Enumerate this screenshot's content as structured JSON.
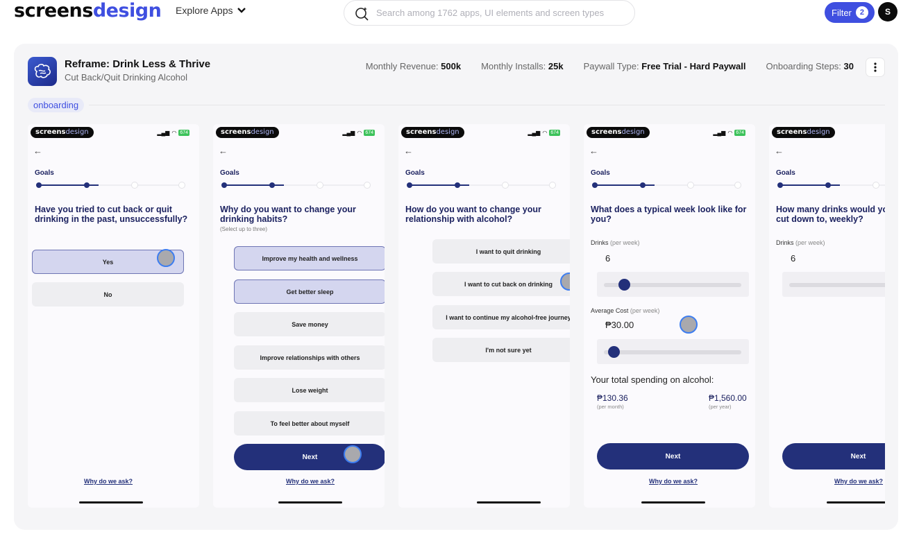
{
  "topbar": {
    "logo_a": "screens",
    "logo_b": "design",
    "explore_label": "Explore Apps",
    "search_placeholder": "Search among 1762 apps, UI elements and screen types",
    "filter_label": "Filter",
    "filter_count": "2",
    "avatar_initial": "S"
  },
  "app": {
    "title": "Reframe: Drink Less & Thrive",
    "subtitle": "Cut Back/Quit Drinking Alcohol",
    "stats": [
      {
        "label": "Monthly Revenue:",
        "value": "500k"
      },
      {
        "label": "Monthly Installs:",
        "value": "25k"
      },
      {
        "label": "Paywall Type:",
        "value": "Free Trial - Hard Paywall"
      },
      {
        "label": "Onboarding Steps:",
        "value": "30"
      }
    ],
    "tag": "onboarding"
  },
  "screen_common": {
    "badge_a": "screens",
    "badge_b": "design",
    "battery": "674",
    "back": "←",
    "section": "Goals",
    "why": "Why do we ask?",
    "next": "Next"
  },
  "screens": {
    "s1": {
      "question": "Have you tried to cut back or quit drinking in the past, unsuccessfully?",
      "options": [
        "Yes",
        "No"
      ]
    },
    "s2": {
      "question": "Why do you want to change your drinking habits?",
      "hint": "(Select up to three)",
      "options": [
        "Improve my health and wellness",
        "Get better sleep",
        "Save money",
        "Improve relationships with others",
        "Lose weight",
        "To feel better about myself"
      ]
    },
    "s3": {
      "question": "How do you want to change your relationship with alcohol?",
      "options": [
        "I want to quit drinking",
        "I want to cut back on drinking",
        "I want to continue my alcohol-free journey",
        "I'm not sure yet"
      ]
    },
    "s4": {
      "question": "What does a typical week look like for you?",
      "drinks_label": "Drinks",
      "drinks_unit": "(per week)",
      "drinks_value": "6",
      "cost_label": "Average Cost",
      "cost_unit": "(per week)",
      "cost_value": "₱30.00",
      "total_label": "Your total spending on alcohol:",
      "month_value": "₱130.36",
      "month_unit": "(per month)",
      "year_value": "₱1,560.00",
      "year_unit": "(per year)"
    },
    "s5": {
      "question": "How many drinks would yo cut down to, weekly?",
      "drinks_label": "Drinks",
      "drinks_unit": "(per week)",
      "drinks_value": "6"
    }
  },
  "colors": {
    "brand": "#3f4fe0",
    "navy": "#23307a",
    "tap": "#3d7df0"
  }
}
